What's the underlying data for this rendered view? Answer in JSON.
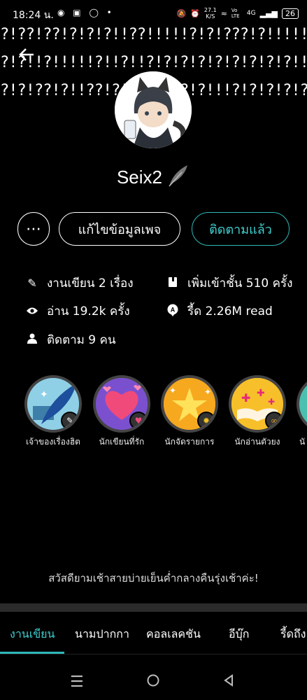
{
  "status_bar": {
    "time": "18:24 น.",
    "net_speed": "27.1",
    "net_unit": "K/S",
    "volte": "Vo LTE",
    "network": "4G",
    "battery": "26"
  },
  "banner": {
    "row1": "?!??!??!?!?!?!!??!!!!!?!?!???!?!!!!!?!?",
    "row2": "?!?!!?!!!!!?!!?!!?!?!?!?!?!?!?!?!?!!?!?!",
    "row3": "?!?!??!?!!??!?!?!!!?!?!?!!!?!?!?!?!??!?!"
  },
  "profile": {
    "name": "Seix2"
  },
  "buttons": {
    "more": "⋯",
    "edit": "แก้ไขข้อมูลเพจ",
    "follow": "ติดตามแล้ว"
  },
  "stats": {
    "works": "งานเขียน 2 เรื่อง",
    "shelved": "เพิ่มเข้าชั้น 510 ครั้ง",
    "reads": "อ่าน 19.2k ครั้ง",
    "reads_total": "รี้ด 2.26M read",
    "following": "ติดตาม 9 คน"
  },
  "badges": [
    {
      "label": "เจ้าของเรื่องฮิต",
      "icon": "quill-icon"
    },
    {
      "label": "นักเขียนที่รัก",
      "icon": "heart-icon"
    },
    {
      "label": "นักจัดรายการ",
      "icon": "stars-icon"
    },
    {
      "label": "นักอ่านตัวยง",
      "icon": "open-book-icon"
    },
    {
      "label": "นั",
      "icon": "badge-icon"
    }
  ],
  "bio": "สวัสดียามเช้าสายบ่ายเย็นค่ำกลางคืนรุ่งเช้าค่ะ!",
  "tabs": [
    "งานเขียน",
    "นามปากกา",
    "คอลเลคชัน",
    "อีบุ๊ก",
    "รี้ดถึง"
  ],
  "colors": {
    "accent": "#2fb8b8",
    "background": "#000000"
  }
}
